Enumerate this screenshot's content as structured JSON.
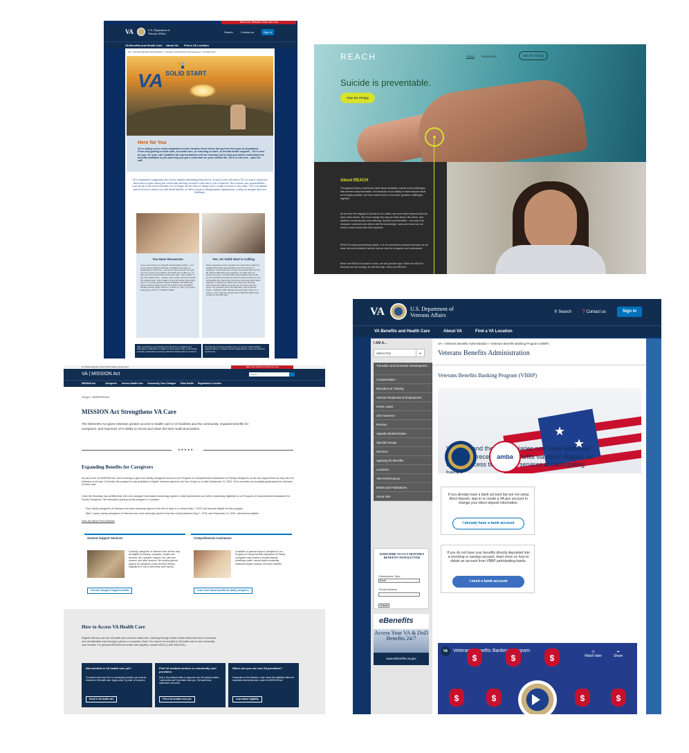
{
  "colors": {
    "va_navy": "#112e51",
    "va_blue": "#0071bb",
    "crisis_red": "#c31d26",
    "reach_yellow": "#d7e32a"
  },
  "solid_start": {
    "crisis_line": "Talk to the Veterans Crisis Line now",
    "logo": "VA",
    "department": "U.S. Department of Veterans Affairs",
    "search": "Search",
    "contact": "Contact us",
    "sign_in": "Sign in",
    "nav": [
      "VA Benefits and Health Care",
      "About VA",
      "Find a VA Location"
    ],
    "breadcrumb": "VA » Veterans Benefits Administration » Transition and Economic Development » VA Solid Start",
    "hero_logo_va": "VA",
    "hero_logo_text": "SOLID START",
    "here_heading": "Here for You",
    "here_text": "VA is calling every newly separated service member three times during their first year of separation. From help getting a home loan, to health care, to returning to work, to mental health support – VA is here for you. It's your call. Qualified VA representatives will be reaching out to help you better understand the benefits available to you and help you get a solid start on your civilian life. VA is on the line – take the call!",
    "intro": "VA is committed to supporting every service member transitioning from service. As part of your welcome to VA, we want to inform you about what to expect during this critical time and help you build a solid start to your civilian life. New routines, new responsibilities... your one out of the services presents a lot of change, but the stress of change is not a weight you have to carry alone. VA is your partner, and we're here to connect you with decent benefits, as well as resources through partner organizations, to help you navigate these new challenges.",
    "col1_title": "You Have Resources",
    "col1_text": "If you need support for a specific mental health problem – or if you're having problems sleeping, controlling your anger, or readjusting to civilian life – you are not alone. And we can help. You don't need to be enrolled in VA health care to talk to us. To learn how VA mental health services can help. Call or walk in to any VA medical center – anytime, day or night. Find your nearest VA medical center. Call or walk in to any Vet Center during clinic hours. If you have questions about enrolling in VA health care, call our toll-free hotline at 1-877-222-VETS (1-877-222-8387) Monday through Friday, 8:00 a.m. to 8:00 p.m. (ET). If you have hearing loss, call TTY: 1-800-877-8339.",
    "col2_title": "Yes, VA Solid Start is Calling",
    "col2_text": "Newly separated service members can expect three calls from qualified Solid Start representatives over the first year of separation. VA will attempt to contact you several times around 90, 180 and 365 days post-separation, so make sure you answer the phone. VA Solid Start representatives will not ask you for financial information and will only discuss topics you are comfortable with. Remember that phone scammers often target Veterans, so always be vigilant and protect your financial information when talking to people you don't know over the phone. For questions about VA Solid Start, call our toll-free hotline: 1-800-827-1000. Monday through Friday, 8:00 a.m to 9:00 p.m. (ET). Take the call and save 1-800-827-1000 as the contact for VA Solid Start!",
    "foot1": "Stay connected to your benefits and resources by updating your information in eBenefits. In addition to these phone calls, you'll receive reminder emails about upcoming calls that includes links to resources.",
    "foot2": "Find Veteran resources located near you, such as health facilities, regional offices, or Veteran Service Organizations, using the Resource Locator tool."
  },
  "reach": {
    "brand": "REACH",
    "nav": [
      "About",
      "Resources"
    ],
    "pledge_button": "Take the Pledge",
    "headline": "Suicide is preventable.",
    "cta": "Take the Pledge",
    "about_heading": "About REACH",
    "about_p1": "Throughout history, Americans have faced obstacles, barriers and challenges that seemed insurmountable. But because of our ability to reach beyond what we thought possible, we have solved some of society's greatest challenges together.",
    "about_p2": "As we face the tragedy of suicide in our nation, we must reach beyond what we have done before. We must change the way we think about, talk about, and address emotional pain and suffering. Suicide is preventable – but only if we empower ourselves and others with the knowledge, tools and resources we need to reach those who feel hopeless.",
    "about_p3": "REACH is about preventing suicide. It is for and about everyone because we all have risk and protective factors that we need to recognize and understand.",
    "about_p4": "When we REACH to those in need, we will provide hope. When we REACH because we are hurting, we will find help. When we REACH,"
  },
  "mission_act": {
    "gov_banner": "An official website of the United States government",
    "crisis_line": "Talk to the Veterans Crisis Line now",
    "header_title": "VA | MISSION Act",
    "search_placeholder": "Search",
    "nav": [
      "MISSION Act",
      "Caregivers",
      "Access Health Care",
      "Community Care Changes",
      "Tribal Health",
      "Regulations in Action"
    ],
    "breadcrumb": "VA.gov › MISSION Act",
    "title": "MISSION Act Strengthens VA Care",
    "lead": "The MISSION Act gives Veterans greater access to health care in VA facilities and the community, expands benefits for caregivers, and improves VA's ability to recruit and retain the best medical providers.",
    "divider": "★★★★★",
    "h_caregivers": "Expanding Benefits for Caregivers",
    "p1": "As part of the VA MISSION Act, we're working to give more family caregivers access to the Program of Comprehensive Assistance for Family Caregivers so we can support them as they care for Veterans of all eras. Currently, this program is only available to eligible Veterans injured in the line of duty on or after September 11, 2001. VA is currently not accepting applications for Veterans of other eras.",
    "p2": "Once the Secretary has certified that VA's new caregiver information technology system is fully implemented, we will be expanding eligibility for our Program of Comprehensive Assistance for Family Caregivers. We anticipate opening up this program in 2 phases:",
    "bullet1": "First, family caregivers of Veterans who were seriously injured in the line of duty on or before May 7, 1975, will become eligible for this program.",
    "bullet2": "After 2 years, family caregivers of Veterans who were seriously injured in the line of duty between May 7, 1975, and September 11, 2001, will become eligible.",
    "press_link": "View the latest Press Release",
    "card1_title": "General Support Services",
    "card1_text": "Currently, caregivers of Veterans from all eras may be eligible for training, education, respite care services, the Caregiver Support Line, self-care courses, and other services. We provide general support for caregivers of any enrolled Veteran, regardless of how or when they were injured.",
    "card1_btn": "Visit the Caregiver Support website",
    "card2_title": "Comprehensive Assistance",
    "card2_text": "In addition to general support, caregivers in our Program of Comprehensive Assistance for Family Caregivers may receive a monthly stipend, beneficiary travel, mental health counseling, enhanced respite services, and other benefits.",
    "card2_btn": "Learn more about benefits for family caregivers",
    "h_access": "How to Access VA Health Care",
    "access_text": "Eligible Veterans can use VA health care services nationwide, including through mobile health clinics that serve rural areas and via telehealth (care through a phone or computer). Note: You need to be enrolled in VA health care to use community care benefits. For general MISSION Act health care inquiries, contact VA311 (1-844-698-2311).",
    "boxes": [
      {
        "title": "Not enrolled in VA health care yet?",
        "text": "To receive care from VA or a community provider, you must be enrolled in VA health care. Apply online, by mail, or in person.",
        "btn": "Enroll in VA health care"
      },
      {
        "title": "Find VA medical centers or community care providers",
        "text": "Find a VA medical center or approved non-VA medical (called \"community care\") providers near you. Get wait times, addresses, and more.",
        "btn": "Find a VA location near you"
      },
      {
        "title": "When can you use non-VA providers?",
        "text": "It depends on the situation. Learn about the eligibility criteria for expanded community care, under the MISSION Act",
        "btn": "Learn about eligibility"
      }
    ]
  },
  "vbbp": {
    "logo": "VA",
    "department": "U.S. Department of Veterans Affairs",
    "search": "Search",
    "contact": "Contact us",
    "sign_in": "Sign in",
    "nav": [
      "VA Benefits and Health Care",
      "About VA",
      "Find a VA Location"
    ],
    "i_am": "I AM A...",
    "select_one": "Select One",
    "menu": [
      "Transition and Economic Development",
      "Compensation",
      "Education & Training",
      "Veteran Readiness & Employment",
      "Home Loans",
      "Life Insurance",
      "Pension",
      "Appeals Modernization",
      "Special Groups",
      "Services",
      "Applying for Benefits",
      "Locations",
      "VBA Performance",
      "Media and Publications",
      "About VBA"
    ],
    "newsletter_title": "SUBSCRIBE TO VA'S MONTHLY BENEFITS NEWSLETTER",
    "subscription_type": "Subscription Type",
    "subscription_value": "Email",
    "email_label": "*Email Address",
    "submit": "Submit",
    "ebenefits_logo": "eBenefits",
    "ebenefits_tagline": "Access Your VA & DoD Benefits 24/7",
    "ebenefits_url": "www.ebenefits.va.gov",
    "breadcrumb": "VA » Veterans Benefits Administration » Veterans Benefits Banking Program (VBBP)",
    "title": "Veterans Benefits Administration",
    "subtitle": "Veterans Benefits Banking Program (VBBP)",
    "banner_text": "Veterans and their beneficiaries now have additional options for receiving VA benefits via direct deposit, as well as access to financial services at participating banks.",
    "amba": "amba",
    "box1_text": "If you already have a bank account but are not using direct deposit, sign in or create a VA.gov account to change your direct deposit information.",
    "box1_btn": "I already have a bank account",
    "box2_text": "If you do not have your benefits directly deposited into a checking or savings account, learn more on how to obtain an account from VBBP participating banks.",
    "box2_btn": "I need a bank account",
    "video_logo": "VA",
    "video_title": "Veterans Benefits Banking Program",
    "watch_later": "Watch later",
    "share": "Share",
    "money": "$"
  }
}
